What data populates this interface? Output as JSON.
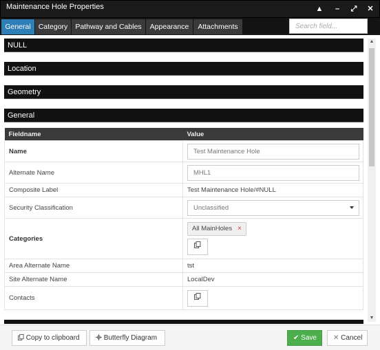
{
  "window": {
    "title": "Maintenance Hole Properties",
    "controls": {
      "collapse": "▲",
      "minimize": "–",
      "maximize": "⤢",
      "close": "✕"
    }
  },
  "tabs": [
    {
      "label": "General",
      "active": true
    },
    {
      "label": "Category",
      "active": false
    },
    {
      "label": "Pathway and Cables",
      "active": false
    },
    {
      "label": "Appearance",
      "active": false
    },
    {
      "label": "Attachments",
      "active": false
    }
  ],
  "search": {
    "placeholder": "Search field..."
  },
  "sections": [
    "NULL",
    "Location",
    "Geometry",
    "General"
  ],
  "table": {
    "headers": {
      "fieldname": "Fieldname",
      "value": "Value"
    },
    "rows": {
      "name": {
        "label": "Name",
        "value": "Test Maintenance Hole"
      },
      "alternate_name": {
        "label": "Alternate Name",
        "value": "MHL1"
      },
      "composite_label": {
        "label": "Composite Label",
        "value": "Test Maintenance Hole/#NULL"
      },
      "security_classification": {
        "label": "Security Classification",
        "value": "Unclassified"
      },
      "categories": {
        "label": "Categories",
        "tags": [
          "All MainHoles"
        ],
        "tag_remove": "×"
      },
      "area_alternate_name": {
        "label": "Area Alternate Name",
        "value": "tst"
      },
      "site_alternate_name": {
        "label": "Site Alternate Name",
        "value": "LocalDev"
      },
      "contacts": {
        "label": "Contacts"
      }
    }
  },
  "footer": {
    "copy_label": "Copy to clipboard",
    "butterfly_label": "Butterfly Diagram",
    "save_label": "Save",
    "cancel_label": "Cancel"
  },
  "icons": {
    "copy": "copy-icon",
    "butterfly": "butterfly-icon",
    "check": "check-icon",
    "close": "close-icon"
  },
  "colors": {
    "tab_active": "#2e7eb8",
    "save": "#4cae4c",
    "section_bg": "#111111"
  }
}
